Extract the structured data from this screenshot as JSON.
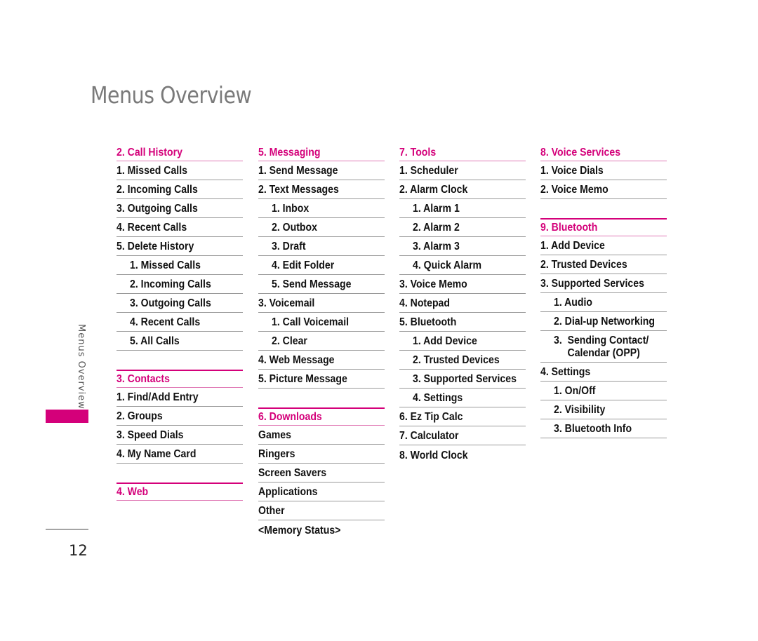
{
  "page": {
    "title": "Menus Overview",
    "side_label": "Menus Overview",
    "page_number": "12",
    "accent_color": "#d4007a"
  },
  "columns": [
    {
      "sections": [
        {
          "heading": "2. Call History",
          "items": [
            {
              "label": "1.  Missed Calls",
              "level": 1
            },
            {
              "label": "2.  Incoming Calls",
              "level": 1
            },
            {
              "label": "3.  Outgoing Calls",
              "level": 1
            },
            {
              "label": "4.  Recent Calls",
              "level": 1
            },
            {
              "label": "5.  Delete History",
              "level": 1
            },
            {
              "label": "1.  Missed Calls",
              "level": 2
            },
            {
              "label": "2.  Incoming Calls",
              "level": 2
            },
            {
              "label": "3.  Outgoing Calls",
              "level": 2
            },
            {
              "label": "4.  Recent Calls",
              "level": 2
            },
            {
              "label": "5.  All Calls",
              "level": 2
            }
          ]
        },
        {
          "heading": "3. Contacts",
          "items": [
            {
              "label": "1.  Find/Add Entry",
              "level": 1
            },
            {
              "label": "2.  Groups",
              "level": 1
            },
            {
              "label": "3.  Speed Dials",
              "level": 1
            },
            {
              "label": "4.  My Name Card",
              "level": 1
            }
          ]
        },
        {
          "heading": "4. Web",
          "items": []
        }
      ]
    },
    {
      "sections": [
        {
          "heading": "5. Messaging",
          "items": [
            {
              "label": "1.  Send Message",
              "level": 1
            },
            {
              "label": "2.  Text Messages",
              "level": 1
            },
            {
              "label": "1.  Inbox",
              "level": 2
            },
            {
              "label": "2.  Outbox",
              "level": 2
            },
            {
              "label": "3.  Draft",
              "level": 2
            },
            {
              "label": "4.  Edit Folder",
              "level": 2
            },
            {
              "label": "5.  Send Message",
              "level": 2
            },
            {
              "label": "3.  Voicemail",
              "level": 1
            },
            {
              "label": "1.  Call Voicemail",
              "level": 2
            },
            {
              "label": "2.  Clear",
              "level": 2
            },
            {
              "label": "4.  Web Message",
              "level": 1
            },
            {
              "label": "5.  Picture Message",
              "level": 1
            }
          ]
        },
        {
          "heading": "6.  Downloads",
          "items": [
            {
              "label": "Games",
              "level": 1
            },
            {
              "label": "Ringers",
              "level": 1
            },
            {
              "label": "Screen Savers",
              "level": 1
            },
            {
              "label": "Applications",
              "level": 1
            },
            {
              "label": "Other",
              "level": 1
            },
            {
              "label": "<Memory Status>",
              "level": 1
            }
          ]
        }
      ]
    },
    {
      "sections": [
        {
          "heading": "7. Tools",
          "items": [
            {
              "label": "1. Scheduler",
              "level": 1
            },
            {
              "label": "2. Alarm Clock",
              "level": 1
            },
            {
              "label": "1.  Alarm 1",
              "level": 2
            },
            {
              "label": "2.  Alarm 2",
              "level": 2
            },
            {
              "label": "3.  Alarm 3",
              "level": 2
            },
            {
              "label": "4.  Quick Alarm",
              "level": 2
            },
            {
              "label": "3.  Voice Memo",
              "level": 1
            },
            {
              "label": "4.  Notepad",
              "level": 1
            },
            {
              "label": "5.  Bluetooth",
              "level": 1
            },
            {
              "label": "1.  Add Device",
              "level": 2
            },
            {
              "label": "2.  Trusted Devices",
              "level": 2
            },
            {
              "label": "3.  Supported Services",
              "level": 2
            },
            {
              "label": "4.  Settings",
              "level": 2
            },
            {
              "label": "6.  Ez Tip Calc",
              "level": 1
            },
            {
              "label": "7.  Calculator",
              "level": 1
            },
            {
              "label": "8.  World Clock",
              "level": 1
            }
          ]
        }
      ]
    },
    {
      "sections": [
        {
          "heading": "8.  Voice Services",
          "items": [
            {
              "label": "1.  Voice Dials",
              "level": 1
            },
            {
              "label": "2.  Voice Memo",
              "level": 1
            }
          ]
        },
        {
          "heading": "9. Bluetooth",
          "items": [
            {
              "label": "1.  Add Device",
              "level": 1
            },
            {
              "label": "2.  Trusted Devices",
              "level": 1
            },
            {
              "label": "3.  Supported Services",
              "level": 1
            },
            {
              "label": "1.  Audio",
              "level": 2
            },
            {
              "label": "2.  Dial-up Networking",
              "level": 2
            },
            {
              "label": "3.  Sending Contact/\n     Calendar (OPP)",
              "level": 2
            },
            {
              "label": "4.  Settings",
              "level": 1
            },
            {
              "label": "1.  On/Off",
              "level": 2
            },
            {
              "label": "2.  Visibility",
              "level": 2
            },
            {
              "label": "3.  Bluetooth Info",
              "level": 2
            }
          ]
        }
      ]
    }
  ]
}
